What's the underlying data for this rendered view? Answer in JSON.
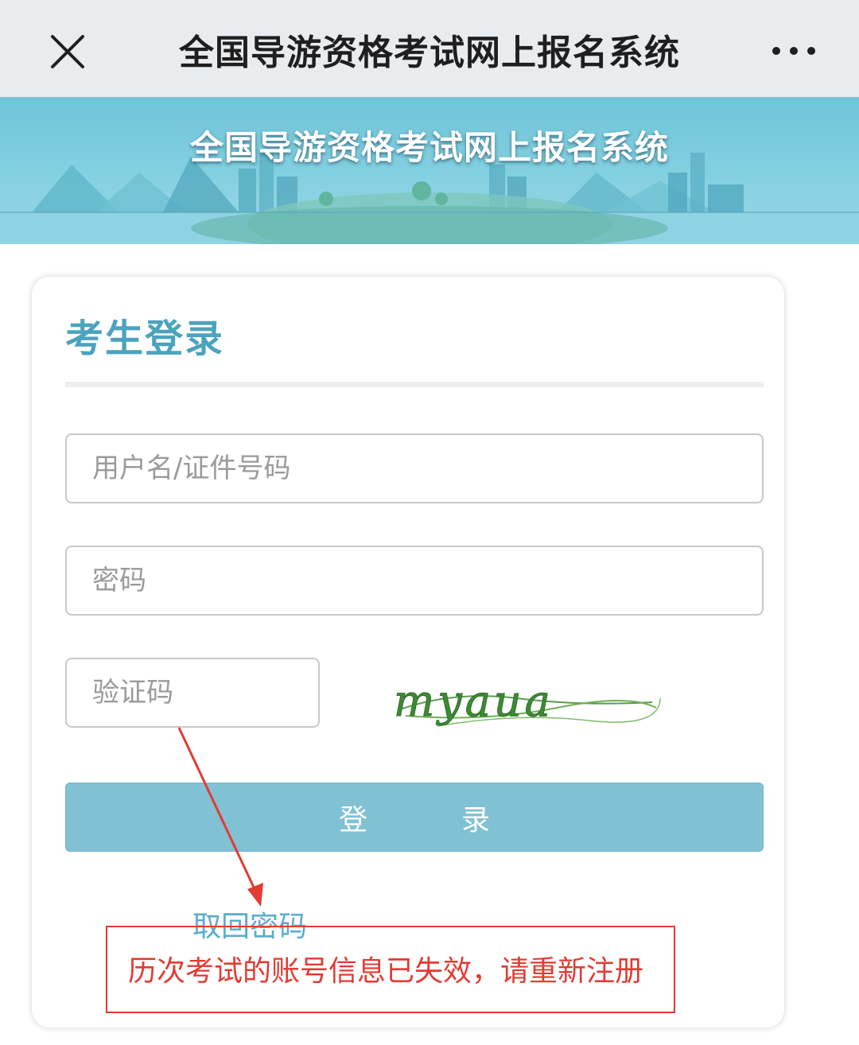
{
  "titlebar": {
    "title": "全国导游资格考试网上报名系统",
    "close_icon": "close-icon",
    "more_icon": "more-dots-icon"
  },
  "banner": {
    "title": "全国导游资格考试网上报名系统"
  },
  "login": {
    "heading": "考生登录",
    "username_placeholder": "用户名/证件号码",
    "password_placeholder": "密码",
    "captcha_placeholder": "验证码",
    "captcha_text": "myaua",
    "login_button": "登录",
    "retrieve_password": "取回密码"
  },
  "annotation": {
    "notice": "历次考试的账号信息已失效，请重新注册"
  },
  "colors": {
    "accent": "#4ba3bd",
    "button": "#80c1d3",
    "annotation": "#e23b33"
  }
}
